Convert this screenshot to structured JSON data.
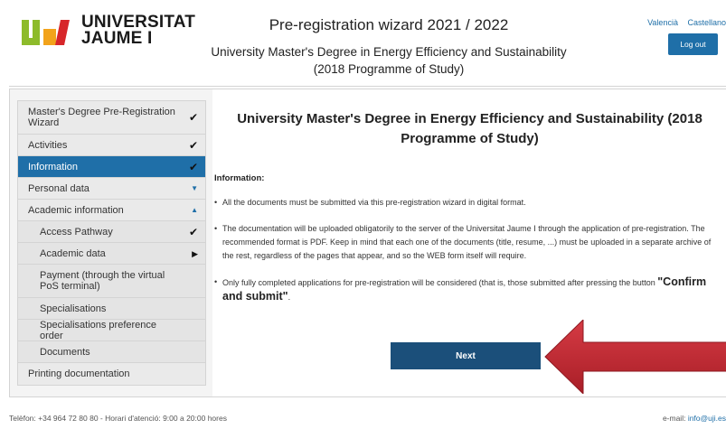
{
  "header": {
    "logo_text_line1": "UNIVERSITAT",
    "logo_text_line2": "JAUME I",
    "wizard_title": "Pre-registration wizard 2021 / 2022",
    "degree_line1": "University Master's Degree in Energy Efficiency and Sustainability",
    "degree_line2": "(2018 Programme of Study)",
    "lang_valencia": "Valencià",
    "lang_castellano": "Castellano",
    "logout_label": "Log out"
  },
  "sidebar": {
    "items": [
      {
        "label": "Master's Degree Pre-Registration Wizard",
        "mark": "✔"
      },
      {
        "label": "Activities",
        "mark": "✔"
      },
      {
        "label": "Information",
        "mark": "✔"
      },
      {
        "label": "Personal data",
        "mark": "▼"
      },
      {
        "label": "Academic information",
        "mark": "▲"
      },
      {
        "label": "Access Pathway",
        "mark": "✔"
      },
      {
        "label": "Academic data",
        "mark": "▶"
      },
      {
        "label": "Payment (through the virtual PoS terminal)",
        "mark": ""
      },
      {
        "label": "Specialisations",
        "mark": ""
      },
      {
        "label": "Specialisations preference order",
        "mark": ""
      },
      {
        "label": "Documents",
        "mark": ""
      },
      {
        "label": "Printing documentation",
        "mark": ""
      }
    ]
  },
  "content": {
    "title": "University Master's Degree in Energy Efficiency and Sustainability (2018 Programme of Study)",
    "info_label": "Information:",
    "bullet1": "All the documents must be submitted via this pre-registration wizard in digital format.",
    "bullet2": "The documentation will be uploaded obligatorily to the server of the Universitat Jaume I through the application of pre-registration. The recommended format is PDF. Keep in mind that each one of the documents (title, resume, ...) must be uploaded in a separate archive of the rest, regardless of the pages that appear, and so the WEB form itself will require.",
    "bullet3_pre": "Only fully completed applications for pre-registration will be considered (that is, those submitted after pressing the button ",
    "bullet3_strong": "\"Confirm and submit\"",
    "bullet3_post": ".",
    "next_label": "Next"
  },
  "footer": {
    "phone_text": "Telèfon: +34 964 72 80 80 - Horari d'atenció: 9:00 a 20:00 hores",
    "email_prefix": "e-mail: ",
    "email": "info@uji.es"
  },
  "colors": {
    "accent_blue": "#1f6fa8",
    "next_button": "#1b4f7a",
    "arrow_red": "#c8242f",
    "logo_green": "#8dbb2b",
    "logo_orange": "#f2a31b",
    "logo_red": "#d7262a"
  }
}
